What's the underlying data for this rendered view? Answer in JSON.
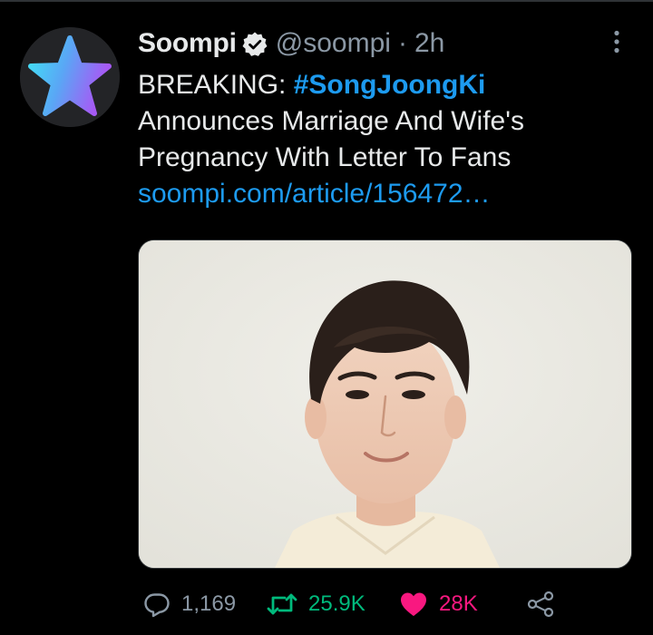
{
  "tweet": {
    "author": {
      "display_name": "Soompi",
      "handle": "@soompi",
      "separator": "·",
      "time": "2h",
      "verified": true,
      "avatar_icon": "star-logo-icon"
    },
    "text": {
      "prefix": "BREAKING:",
      "hashtag": "#SongJoongKi",
      "line2": "Announces Marriage And Wife's",
      "line3": "Pregnancy With Letter To Fans",
      "link": "soompi.com/article/156472…"
    },
    "media": {
      "type": "photo"
    },
    "stats": {
      "replies": "1,169",
      "retweets": "25.9K",
      "likes": "28K"
    }
  },
  "colors": {
    "background": "#000000",
    "text_primary": "#e7e9ea",
    "text_secondary": "#8b98a5",
    "link_accent": "#1d9bf0",
    "retweet_active": "#00ba7c",
    "like_active": "#f91880"
  },
  "icons": {
    "more": "more-vertical-icon",
    "reply": "reply-bubble-icon",
    "retweet": "retweet-arrows-icon",
    "like": "heart-filled-icon",
    "share": "share-nodes-icon",
    "verified": "verified-badge-icon"
  }
}
